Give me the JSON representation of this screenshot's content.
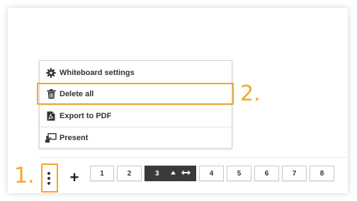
{
  "menu": {
    "items": [
      {
        "label": "Whiteboard settings",
        "icon": "gear-icon"
      },
      {
        "label": "Delete all",
        "icon": "trash-icon"
      },
      {
        "label": "Export to PDF",
        "icon": "pdf-file-icon"
      },
      {
        "label": "Present",
        "icon": "presentation-icon"
      }
    ]
  },
  "annotations": {
    "step1": "1.",
    "step2": "2.",
    "highlight_color": "#f5a623"
  },
  "toolbar": {
    "add_label": "+",
    "pages": [
      "1",
      "2",
      "3",
      "4",
      "5",
      "6",
      "7",
      "8"
    ],
    "active_page": "3",
    "active_color": "#3a3a3a"
  }
}
